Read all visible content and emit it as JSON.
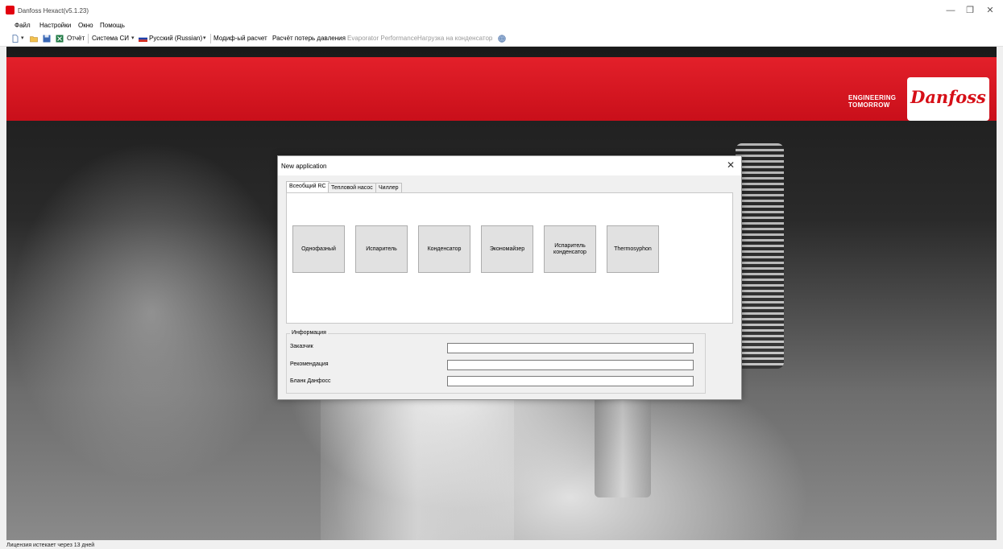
{
  "window": {
    "title": "Danfoss Hexact(v5.1.23)",
    "controls": {
      "minimize": "—",
      "restore": "❐",
      "close": "✕"
    }
  },
  "menu": [
    "Файл",
    "Настройки",
    "Окно",
    "Помощь"
  ],
  "toolbar": {
    "report": "Отчёт",
    "units": "Система СИ",
    "language": "Русский (Russian)",
    "modified_calc": "Модиф-ый расчет",
    "pressure_loss": "Расчёт потерь давления",
    "evaporator_perf": "Evaporator Performance",
    "condenser_load": "Нагрузка на конденсатор",
    "icons": [
      "new-file-icon",
      "open-folder-icon",
      "save-icon",
      "excel-icon",
      "russia-flag-icon",
      "globe-icon"
    ]
  },
  "banner": {
    "tagline_line1": "ENGINEERING",
    "tagline_line2": "TOMORROW",
    "logo": "Danfoss",
    "brand_color": "#e2000f"
  },
  "dialog": {
    "title": "New application",
    "close": "✕",
    "tabs": [
      "Всеобщий RC",
      "Тепловой насос",
      "Чиллер"
    ],
    "active_tab": "Всеобщий RC",
    "buttons": [
      "Однофазный",
      "Испаритель",
      "Конденсатор",
      "Экономайзер",
      "Испаритель конденсатор",
      "Thermosyphon"
    ],
    "info": {
      "legend": "Информация",
      "fields": [
        {
          "label": "Заказчик",
          "value": ""
        },
        {
          "label": "Рекомендация",
          "value": ""
        },
        {
          "label": "Бланк Данфосс",
          "value": ""
        }
      ]
    }
  },
  "status": {
    "text": "Лицензия истекает через 13 дней"
  }
}
